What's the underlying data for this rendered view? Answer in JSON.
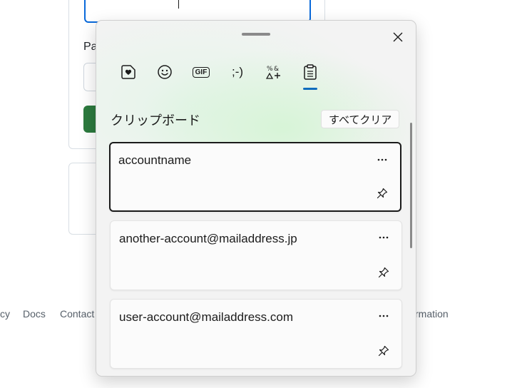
{
  "background": {
    "password_label": "Pa",
    "footer_links": [
      "cy",
      "Docs",
      "Contact",
      "rmation"
    ]
  },
  "flyout": {
    "tabs": [
      {
        "icon": "sticker-heart-icon"
      },
      {
        "icon": "emoji-icon"
      },
      {
        "icon": "gif-icon",
        "label": "GIF"
      },
      {
        "icon": "kaomoji-icon",
        "label": ";-)"
      },
      {
        "icon": "symbols-icon"
      },
      {
        "icon": "clipboard-icon",
        "active": true
      }
    ],
    "section_title": "クリップボード",
    "clear_all_label": "すべてクリア",
    "items": [
      {
        "text": "accountname",
        "selected": true
      },
      {
        "text": "another-account@mailaddress.jp"
      },
      {
        "text": "user-account@mailaddress.com"
      }
    ],
    "accent_color": "#0f6cbd"
  }
}
